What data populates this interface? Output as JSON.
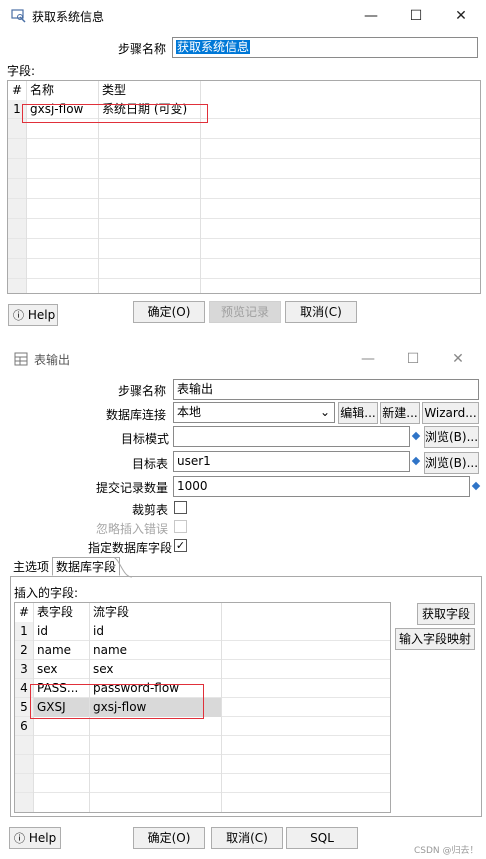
{
  "dialog1": {
    "title": "获取系统信息",
    "step_name_label": "步骤名称",
    "step_name_value": "获取系统信息",
    "fields_label": "字段:",
    "columns": [
      "#",
      "名称",
      "类型"
    ],
    "rows": [
      {
        "num": "1",
        "name": "gxsj-flow",
        "type": "系统日期 (可变)"
      }
    ],
    "help_label": "Help",
    "ok_label": "确定(O)",
    "preview_label": "预览记录",
    "cancel_label": "取消(C)"
  },
  "dialog2": {
    "title": "表输出",
    "step_name_label": "步骤名称",
    "step_name_value": "表输出",
    "db_conn_label": "数据库连接",
    "db_conn_value": "本地",
    "edit_label": "编辑...",
    "new_label": "新建...",
    "wizard_label": "Wizard...",
    "target_schema_label": "目标模式",
    "target_schema_value": "",
    "browse_schema_label": "浏览(B)...",
    "target_table_label": "目标表",
    "target_table_value": "user1",
    "browse_table_label": "浏览(B)...",
    "commit_size_label": "提交记录数量",
    "commit_size_value": "1000",
    "truncate_label": "裁剪表",
    "ignore_errors_label": "忽略插入错误",
    "specify_fields_label": "指定数据库字段",
    "specify_fields_check": "✓",
    "tabs": [
      "主选项",
      "数据库字段"
    ],
    "insert_fields_label": "插入的字段:",
    "columns": [
      "#",
      "表字段",
      "流字段"
    ],
    "rows": [
      {
        "num": "1",
        "table_field": "id",
        "stream_field": "id"
      },
      {
        "num": "2",
        "table_field": "name",
        "stream_field": "name"
      },
      {
        "num": "3",
        "table_field": "sex",
        "stream_field": "sex"
      },
      {
        "num": "4",
        "table_field": "PASS...",
        "stream_field": "password-flow"
      },
      {
        "num": "5",
        "table_field": "GXSJ",
        "stream_field": "gxsj-flow"
      },
      {
        "num": "6",
        "table_field": "",
        "stream_field": ""
      }
    ],
    "get_fields_label": "获取字段",
    "input_mapping_label": "输入字段映射",
    "help_label": "Help",
    "ok_label": "确定(O)",
    "cancel_label": "取消(C)",
    "sql_label": "SQL"
  },
  "watermark": "CSDN @归去！",
  "colors": {
    "selection": "#0078d7",
    "highlight_box": "#e0303a",
    "selected_row": "#d9d9d9"
  }
}
